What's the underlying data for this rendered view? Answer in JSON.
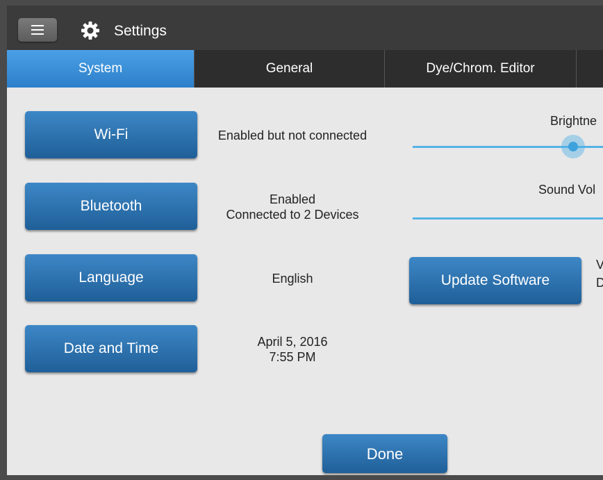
{
  "titlebar": {
    "title": "Settings",
    "menu_icon": "hamburger-menu-icon",
    "settings_icon": "gear-icon"
  },
  "tabs": [
    {
      "label": "System",
      "active": true
    },
    {
      "label": "General",
      "active": false
    },
    {
      "label": "Dye/Chrom. Editor",
      "active": false
    }
  ],
  "settings": [
    {
      "button": "Wi-Fi",
      "status": "Enabled but not connected"
    },
    {
      "button": "Bluetooth",
      "status_line1": "Enabled",
      "status_line2": "Connected to 2 Devices"
    },
    {
      "button": "Language",
      "status": "English"
    },
    {
      "button": "Date and Time",
      "status_line1": "April 5, 2016",
      "status_line2": "7:55 PM"
    }
  ],
  "right_panel": {
    "brightness_label": "Brightne",
    "sound_label": "Sound Vol",
    "update_button": "Update Software",
    "version_fragment_1": "V",
    "version_fragment_2": "D"
  },
  "footer": {
    "done_label": "Done"
  },
  "colors": {
    "accent": "#2d7fc9",
    "slider": "#55b2e6",
    "titlebar": "#3b3b3b"
  }
}
